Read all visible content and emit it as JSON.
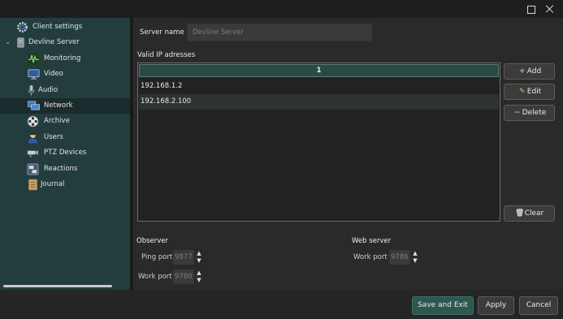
{
  "window": {
    "maximize_icon": "maximize-icon",
    "close_icon": "close-icon"
  },
  "sidebar": {
    "items": [
      {
        "label": "Client settings",
        "icon": "gear-icon"
      },
      {
        "label": "Devline Server",
        "icon": "server-icon"
      },
      {
        "label": "Monitoring",
        "icon": "monitoring-icon"
      },
      {
        "label": "Video",
        "icon": "monitor-icon"
      },
      {
        "label": "Audio",
        "icon": "microphone-icon"
      },
      {
        "label": "Network",
        "icon": "network-icon"
      },
      {
        "label": "Archive",
        "icon": "film-reel-icon"
      },
      {
        "label": "Users",
        "icon": "user-icon"
      },
      {
        "label": "PTZ Devices",
        "icon": "ptz-camera-icon"
      },
      {
        "label": "Reactions",
        "icon": "reactions-icon"
      },
      {
        "label": "Journal",
        "icon": "journal-icon"
      }
    ],
    "selected": "Network"
  },
  "server": {
    "name_label": "Server name",
    "name_placeholder": "Devline Server"
  },
  "ip_table": {
    "title": "Valid IP adresses",
    "column_header": "1",
    "rows": [
      "192.168.1.2",
      "192.168.2.100"
    ]
  },
  "buttons": {
    "add": "Add",
    "edit": "Edit",
    "delete": "Delete",
    "clear": "Clear"
  },
  "observer": {
    "title": "Observer",
    "ping_port_label": "Ping port",
    "ping_port_value": "9877",
    "work_port_label": "Work port",
    "work_port_value": "9780"
  },
  "web_server": {
    "title": "Web server",
    "work_port_label": "Work port",
    "work_port_value": "9786"
  },
  "footer": {
    "save_exit": "Save and Exit",
    "apply": "Apply",
    "cancel": "Cancel"
  },
  "colors": {
    "sidebar_bg": "#233d3f",
    "accent_button": "#2d5750",
    "table_header": "#2b4a45"
  }
}
